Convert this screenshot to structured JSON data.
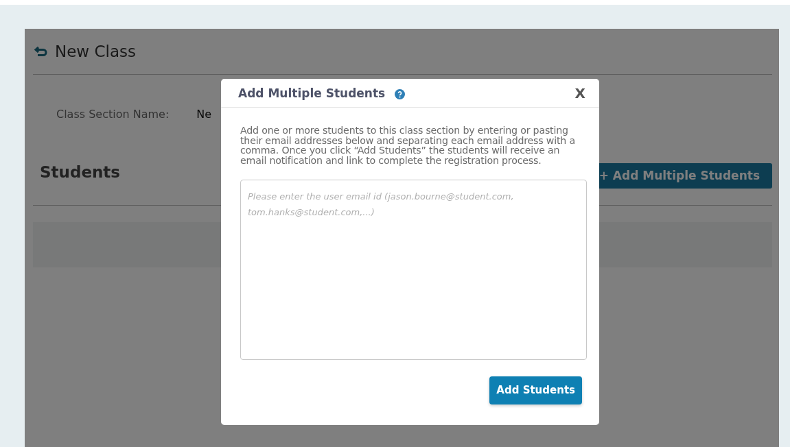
{
  "page": {
    "title": "New Class",
    "section_label": "Class Section Name:",
    "section_value": "Ne",
    "students_heading": "Students",
    "add_multiple_button": "+ Add Multiple Students"
  },
  "modal": {
    "title": "Add Multiple Students",
    "description": "Add one or more students to this class section by entering or pasting their email addresses below and separating each email address with a comma. Once you click “Add Students” the students will receive an email notification and link to complete the registration process.",
    "close": "X",
    "email_field": {
      "placeholder": "Please enter the user email id (jason.bourne@student.com, tom.hanks@student.com,...)"
    },
    "submit_button": "Add Students"
  }
}
